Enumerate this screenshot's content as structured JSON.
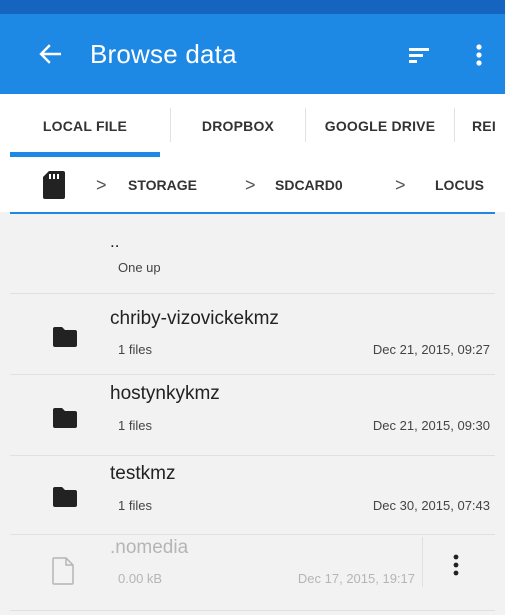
{
  "app": {
    "title": "Browse data",
    "accent": "#1e88e5",
    "status_bar_color": "#1565c0"
  },
  "tabs": [
    {
      "label": "LOCAL FILE",
      "selected": true
    },
    {
      "label": "DROPBOX",
      "selected": false
    },
    {
      "label": "GOOGLE DRIVE",
      "selected": false
    },
    {
      "label": "REI",
      "selected": false
    }
  ],
  "breadcrumb": {
    "root_icon": "sdcard-icon",
    "items": [
      "STORAGE",
      "SDCARD0",
      "LOCUS"
    ],
    "separator": ">"
  },
  "files": [
    {
      "name": "..",
      "subtitle": "One up",
      "date": "",
      "icon": "none"
    },
    {
      "name": "chriby-vizovickekmz",
      "subtitle": "1 files",
      "date": "Dec 21, 2015, 09:27",
      "icon": "folder-icon"
    },
    {
      "name": "hostynkykmz",
      "subtitle": "1 files",
      "date": "Dec 21, 2015, 09:30",
      "icon": "folder-icon"
    },
    {
      "name": "testkmz",
      "subtitle": "1 files",
      "date": "Dec 30, 2015, 07:43",
      "icon": "folder-icon"
    },
    {
      "name": ".nomedia",
      "subtitle": "0.00 kB",
      "date": "Dec 17, 2015, 19:17",
      "icon": "file-icon",
      "dimmed": true
    }
  ]
}
